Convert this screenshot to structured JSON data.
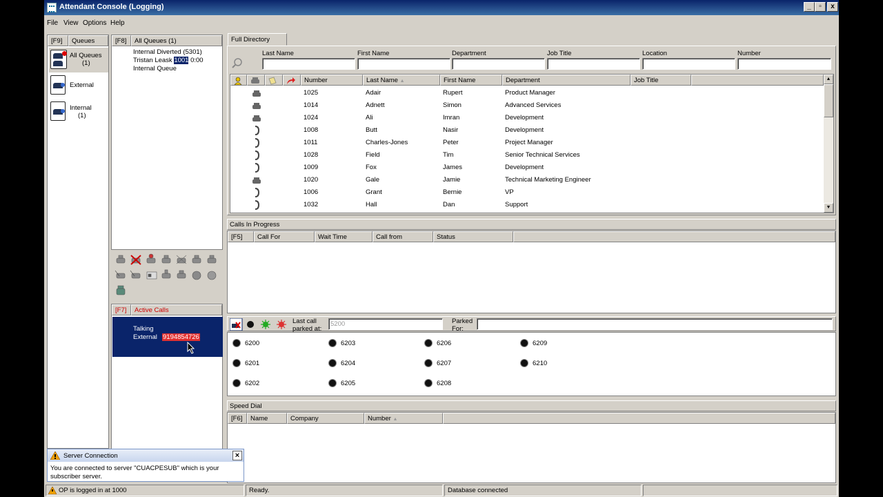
{
  "window": {
    "title": "Attendant Console (Logging)",
    "controls": [
      "_",
      "▫",
      "x"
    ]
  },
  "menu": [
    "File",
    "View",
    "Options",
    "Help"
  ],
  "queues_panel": {
    "key": "[F9]",
    "label": "Queues",
    "items": [
      {
        "label": "All Queues",
        "count": "(1)"
      },
      {
        "label": "External",
        "count": ""
      },
      {
        "label": "Internal",
        "count": "(1)"
      }
    ]
  },
  "all_queues": {
    "key": "[F8]",
    "label": "All Queues (1)",
    "lines": {
      "diverted": "Internal Diverted (5301)",
      "caller_name": "Tristan Leask",
      "caller_number": "1001",
      "caller_time": "0:00",
      "queue": "Internal Queue"
    }
  },
  "active_calls": {
    "key": "[F7]",
    "label": "Active Calls",
    "state": "Talking",
    "type": "External",
    "number": "9194854726"
  },
  "directory": {
    "tab": "Full Directory",
    "search_labels": [
      "Last Name",
      "First Name",
      "Department",
      "Job Title",
      "Location",
      "Number"
    ],
    "columns": [
      "Number",
      "Last Name",
      "First Name",
      "Department",
      "Job Title"
    ],
    "rows": [
      {
        "icon": "desk-phone",
        "number": "1025",
        "last": "Adair",
        "first": "Rupert",
        "dept": "Product Manager"
      },
      {
        "icon": "desk-phone",
        "number": "1014",
        "last": "Adnett",
        "first": "Simon",
        "dept": "Advanced Services"
      },
      {
        "icon": "desk-phone",
        "number": "1024",
        "last": "Ali",
        "first": "Imran",
        "dept": "Development"
      },
      {
        "icon": "handset",
        "number": "1008",
        "last": "Butt",
        "first": "Nasir",
        "dept": "Development"
      },
      {
        "icon": "handset",
        "number": "1011",
        "last": "Charles-Jones",
        "first": "Peter",
        "dept": "Project Manager"
      },
      {
        "icon": "handset",
        "number": "1028",
        "last": "Field",
        "first": "Tim",
        "dept": "Senior Technical Services"
      },
      {
        "icon": "handset",
        "number": "1009",
        "last": "Fox",
        "first": "James",
        "dept": "Development"
      },
      {
        "icon": "desk-phone",
        "number": "1020",
        "last": "Gale",
        "first": "Jamie",
        "dept": "Technical Marketing Engineer"
      },
      {
        "icon": "handset",
        "number": "1006",
        "last": "Grant",
        "first": "Bernie",
        "dept": "VP"
      },
      {
        "icon": "handset",
        "number": "1032",
        "last": "Hall",
        "first": "Dan",
        "dept": "Support"
      }
    ]
  },
  "calls_in_progress": {
    "title": "Calls In Progress",
    "columns": [
      "[F5]",
      "Call For",
      "Wait Time",
      "Call from",
      "Status"
    ]
  },
  "park": {
    "last_call_label": "Last call parked at:",
    "last_call_value": "5200",
    "parked_for_label": "Parked For:",
    "slots": [
      "6200",
      "6201",
      "6202",
      "6203",
      "6204",
      "6205",
      "6206",
      "6207",
      "6208",
      "6209",
      "6210"
    ]
  },
  "speed_dial": {
    "title": "Speed Dial",
    "columns": [
      "[F6]",
      "Name",
      "Company",
      "Number"
    ]
  },
  "notification": {
    "title": "Server Connection",
    "message": "You are connected to server \"CUACPESUB\" which is your subscriber server.",
    "close": "×"
  },
  "status": {
    "login": "OP is logged in at 1000",
    "ready": "Ready.",
    "db": "Database connected"
  }
}
